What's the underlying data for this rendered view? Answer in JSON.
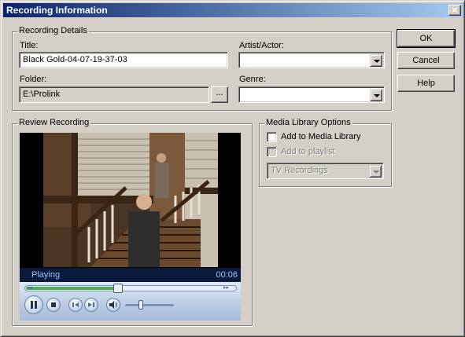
{
  "window": {
    "title": "Recording Information",
    "close_glyph": "×"
  },
  "recording_details": {
    "legend": "Recording Details",
    "title_label": "Title:",
    "title_value": "Black Gold-04-07-19-37-03",
    "artist_label": "Artist/Actor:",
    "artist_value": "",
    "folder_label": "Folder:",
    "folder_value": "E:\\Prolink",
    "browse_label": "...",
    "genre_label": "Genre:",
    "genre_value": ""
  },
  "buttons": {
    "ok": "OK",
    "cancel": "Cancel",
    "help": "Help"
  },
  "review": {
    "legend": "Review Recording",
    "status": "Playing",
    "time": "00:06",
    "seek_fraction": 0.44,
    "volume_fraction": 0.32
  },
  "media_library": {
    "legend": "Media Library Options",
    "add_to_library": "Add to Media Library",
    "add_to_library_checked": false,
    "add_to_playlist": "Add to playlist",
    "add_to_playlist_checked": false,
    "playlist_value": "TV Recordings"
  },
  "icons": {
    "close": "close-icon",
    "pause": "pause-icon",
    "stop": "stop-icon",
    "previous": "previous-icon",
    "next": "next-icon",
    "mute": "speaker-icon",
    "rewind": "rewind-icon",
    "fast_forward": "fast-forward-icon"
  }
}
